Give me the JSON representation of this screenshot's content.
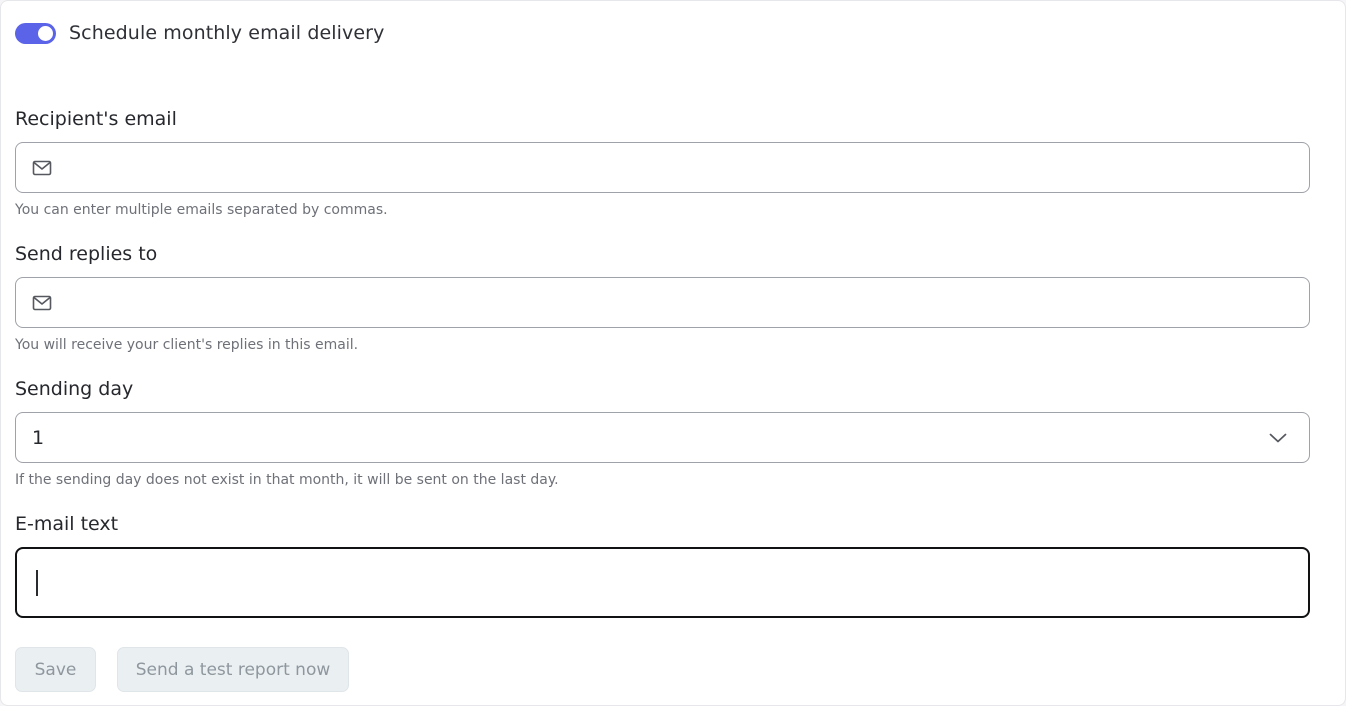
{
  "colors": {
    "accent": "#5b63e8",
    "input_border": "#9fa2a8",
    "focus_border": "#111214",
    "disabled_button_bg": "#eaeff2",
    "disabled_button_text": "#8f979e"
  },
  "schedule": {
    "label": "Schedule monthly email delivery",
    "enabled": true
  },
  "recipient_email": {
    "label": "Recipient's email",
    "value": "",
    "icon": "mail-icon",
    "hint": "You can enter multiple emails separated by commas."
  },
  "reply_to": {
    "label": "Send replies to",
    "value": "",
    "icon": "mail-icon",
    "hint": "You will receive your client's replies in this email."
  },
  "sending_day": {
    "label": "Sending day",
    "selected": "1",
    "icon": "chevron-down-icon",
    "hint": "If the sending day does not exist in that month, it will be sent on the last day."
  },
  "email_text": {
    "label": "E-mail text",
    "value": ""
  },
  "actions": {
    "save_label": "Save",
    "test_label": "Send a test report now"
  }
}
